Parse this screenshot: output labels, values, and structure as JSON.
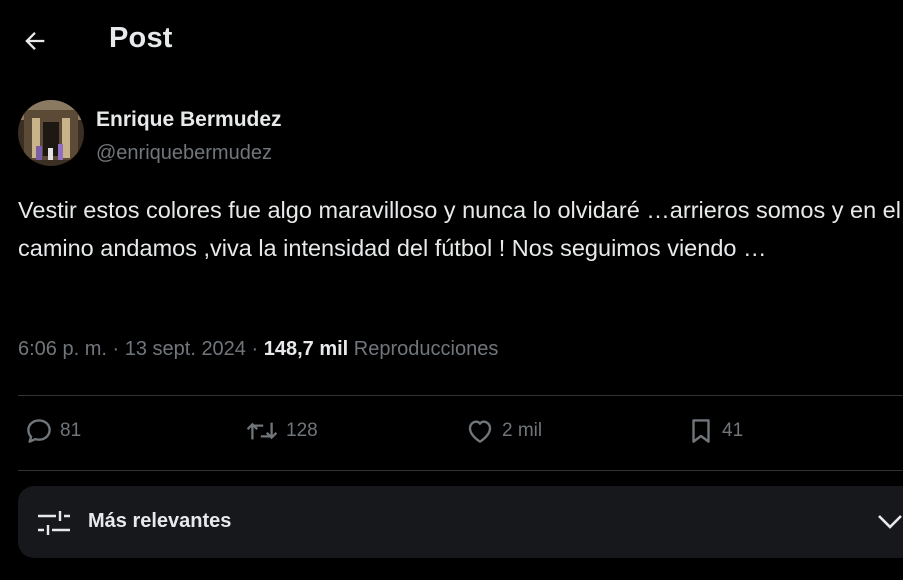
{
  "header": {
    "back_icon": "arrow-left-icon",
    "title": "Post"
  },
  "author": {
    "avatar_icon": "avatar",
    "name": "Enrique Bermudez",
    "handle": "@enriquebermudez"
  },
  "tweet": {
    "text": "Vestir estos colores fue algo maravilloso y nunca lo olvidaré …arrieros somos y en el camino andamos ,viva la intensidad del fútbol ! Nos seguimos viendo …",
    "time": "6:06 p. m.",
    "date": "13 sept. 2024",
    "views_count": "148,7 mil",
    "views_label": "Reproducciones"
  },
  "actions": {
    "replies": "81",
    "reposts": "128",
    "likes": "2 mil",
    "bookmarks": "41"
  },
  "sort": {
    "label": "Más relevantes",
    "icon": "sliders-icon"
  },
  "colors": {
    "background": "#000000",
    "text_primary": "#e7e9ea",
    "text_secondary": "#71767b",
    "divider": "#2f3336",
    "sort_bar": "#16181c"
  }
}
